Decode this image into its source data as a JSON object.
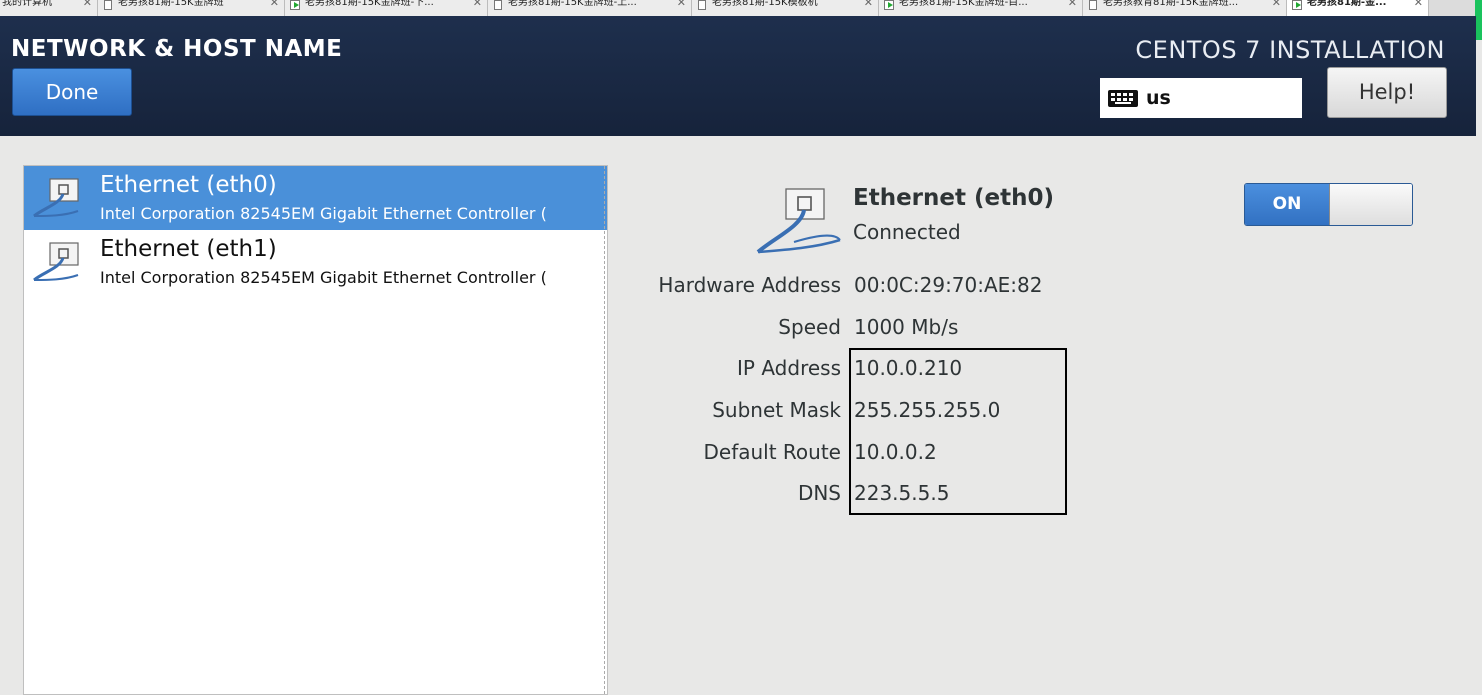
{
  "browser_tabs": [
    {
      "title": "我的计算机",
      "icon": "none"
    },
    {
      "title": "老男孩81期-15K金牌班",
      "icon": "doc"
    },
    {
      "title": "老男孩81期-15K金牌班-下...",
      "icon": "play"
    },
    {
      "title": "老男孩81期-15K金牌班-上...",
      "icon": "doc"
    },
    {
      "title": "老男孩81期-15K模板机",
      "icon": "doc"
    },
    {
      "title": "老男孩81期-15K金牌班-目...",
      "icon": "play"
    },
    {
      "title": "老男孩教育81期-15K金牌班...",
      "icon": "doc"
    },
    {
      "title": "老男孩81期-金...",
      "icon": "play",
      "active": true
    }
  ],
  "header": {
    "title": "NETWORK & HOST NAME",
    "done_label": "Done",
    "product": "CENTOS 7 INSTALLATION",
    "keyboard_layout": "us",
    "help_label": "Help!"
  },
  "devices": [
    {
      "name": "Ethernet (eth0)",
      "description": "Intel Corporation 82545EM Gigabit Ethernet Controller (",
      "selected": true
    },
    {
      "name": "Ethernet (eth1)",
      "description": "Intel Corporation 82545EM Gigabit Ethernet Controller (",
      "selected": false
    }
  ],
  "details": {
    "device_name": "Ethernet (eth0)",
    "status": "Connected",
    "toggle_label": "ON",
    "rows": [
      {
        "label": "Hardware Address",
        "value": "00:0C:29:70:AE:82"
      },
      {
        "label": "Speed",
        "value": "1000 Mb/s"
      },
      {
        "label": "IP Address",
        "value": "10.0.0.210"
      },
      {
        "label": "Subnet Mask",
        "value": "255.255.255.0"
      },
      {
        "label": "Default Route",
        "value": "10.0.0.2"
      },
      {
        "label": "DNS",
        "value": "223.5.5.5"
      }
    ]
  },
  "colors": {
    "header_bg": "#1e2f4d",
    "accent_blue": "#4a90d9",
    "panel_bg": "#e8e8e7"
  }
}
